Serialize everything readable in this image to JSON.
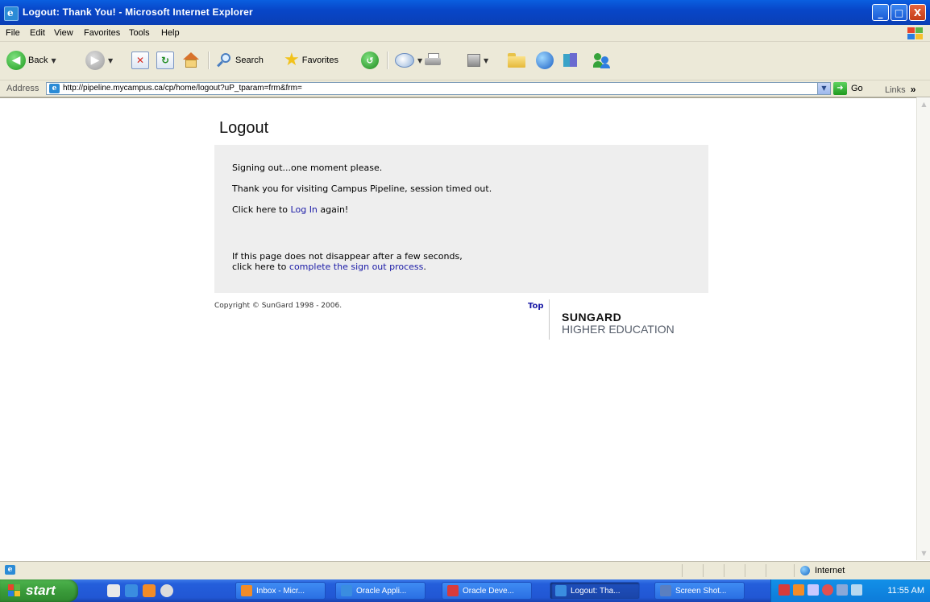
{
  "window": {
    "title": "Logout: Thank You! - Microsoft Internet Explorer",
    "minimize": "_",
    "maximize": "□",
    "close": "X"
  },
  "menu": [
    "File",
    "Edit",
    "View",
    "Favorites",
    "Tools",
    "Help"
  ],
  "toolbar": {
    "back": "Back",
    "search": "Search",
    "favorites": "Favorites"
  },
  "address": {
    "label": "Address",
    "url": "http://pipeline.mycampus.ca/cp/home/logout?uP_tparam=frm&frm=",
    "go": "Go",
    "links": "Links",
    "links_chevron": "»"
  },
  "page": {
    "title": "Logout",
    "signing_out": "Signing out...one moment please.",
    "thank_you": "Thank you for visiting Campus Pipeline, session timed out.",
    "click_here_to": "Click here to",
    "log_in": "Log In",
    "again": "again!",
    "disappear_line1": "If this page does not disappear after a few seconds,",
    "disappear_click": "click here to",
    "complete_link": "complete the sign out process",
    "period": ".",
    "copyright": "Copyright © SunGard 1998 - 2006.",
    "top": "Top",
    "logo_line1": "SUNGARD",
    "logo_line2": "HIGHER EDUCATION"
  },
  "status": {
    "zone": "Internet"
  },
  "taskbar": {
    "start": "start",
    "tasks": [
      {
        "label": "Inbox - Micr...",
        "color": "#f28c28"
      },
      {
        "label": "Oracle Appli...",
        "color": "#3a8de0"
      },
      {
        "label": "Oracle Deve...",
        "color": "#d83b3b"
      },
      {
        "label": "Logout: Tha...",
        "color": "#3a8de0"
      },
      {
        "label": "Screen Shot...",
        "color": "#5a7fc0"
      }
    ],
    "clock": "11:55 AM"
  }
}
